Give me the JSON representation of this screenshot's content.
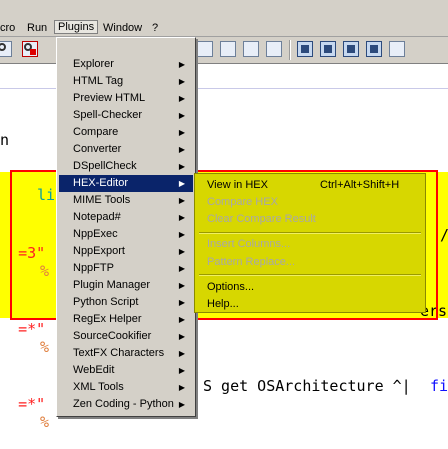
{
  "menubar": {
    "items": [
      "cro",
      "Run",
      "Plugins",
      "Window",
      "?"
    ]
  },
  "editor": {
    "lines": {
      "n": "n",
      "line_frag": "line",
      "row1_left": "=3\"",
      "row1_pct": "%",
      "row1_right": "/",
      "row2_left": "=*\"",
      "row2_pct": "%",
      "row2_right": "ers",
      "row3_left": "=*\"",
      "row3_pct": "%",
      "row3_mid": "S get OSArchitecture ^|",
      "row3_right": "fi"
    }
  },
  "plugins_menu": {
    "items": [
      {
        "label": "Explorer"
      },
      {
        "label": "HTML Tag"
      },
      {
        "label": "Preview HTML"
      },
      {
        "label": "Spell-Checker"
      },
      {
        "label": "Compare"
      },
      {
        "label": "Converter"
      },
      {
        "label": "DSpellCheck"
      },
      {
        "label": "HEX-Editor"
      },
      {
        "label": "MIME Tools"
      },
      {
        "label": "Notepad#"
      },
      {
        "label": "NppExec"
      },
      {
        "label": "NppExport"
      },
      {
        "label": "NppFTP"
      },
      {
        "label": "Plugin Manager"
      },
      {
        "label": "Python Script"
      },
      {
        "label": "RegEx Helper"
      },
      {
        "label": "SourceCookifier"
      },
      {
        "label": "TextFX Characters"
      },
      {
        "label": "WebEdit"
      },
      {
        "label": "XML Tools"
      },
      {
        "label": "Zen Coding - Python"
      }
    ],
    "arrow": "▶"
  },
  "hex_submenu": {
    "view_in_hex": "View in HEX",
    "view_in_hex_shortcut": "Ctrl+Alt+Shift+H",
    "compare_hex": "Compare HEX",
    "clear_compare": "Clear Compare Result",
    "insert_columns": "Insert Columns...",
    "pattern_replace": "Pattern Replace...",
    "options": "Options...",
    "help": "Help..."
  },
  "colors": {
    "menu_bg": "#d4d0c8",
    "selection": "#0a246a",
    "highlight_yellow": "#ffff00",
    "submenu_yellow": "#d7d700",
    "frame_red": "#ff0000"
  }
}
